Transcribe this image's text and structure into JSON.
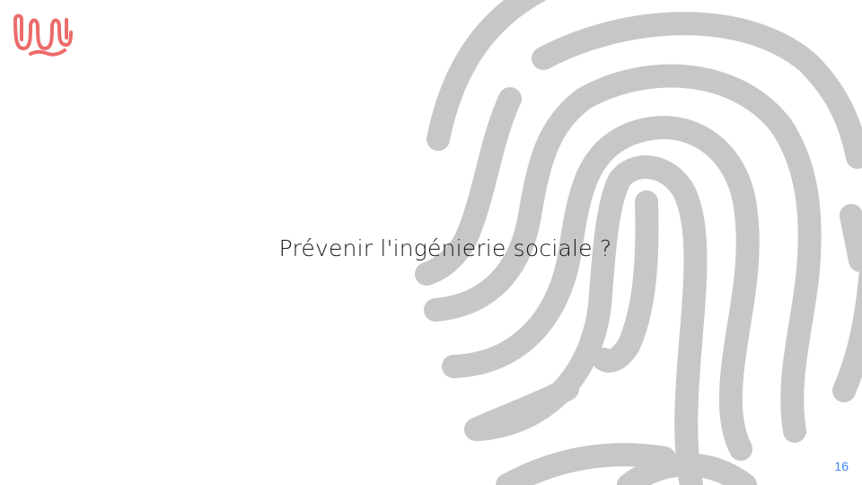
{
  "slide": {
    "title": "Prévenir l'ingénierie sociale ?",
    "page_number": "16"
  },
  "colors": {
    "background": "#ffffff",
    "fingerprint": "#c7c7c7",
    "logo": "#ec6b6b",
    "title_text": "#1a1a1a",
    "page_number": "#3b82f6"
  },
  "icons": {
    "logo": "wave-logo-icon",
    "decoration": "fingerprint-icon"
  }
}
